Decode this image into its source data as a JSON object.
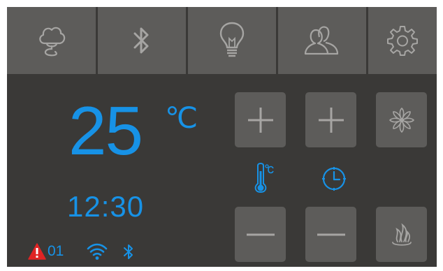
{
  "topbar": {
    "items": [
      {
        "icon": "cloud-icon"
      },
      {
        "icon": "bluetooth-icon"
      },
      {
        "icon": "lightbulb-icon"
      },
      {
        "icon": "users-icon"
      },
      {
        "icon": "gear-icon"
      }
    ]
  },
  "display": {
    "temperature": "25",
    "temperature_unit": "℃",
    "time": "12:30"
  },
  "status": {
    "alarm_count": "01",
    "alarm_icon": "warning-icon",
    "wifi_icon": "wifi-icon",
    "bluetooth_icon": "bluetooth-icon"
  },
  "controls": {
    "temp_icon": "thermometer-celsius-icon",
    "timer_icon": "clock-icon",
    "buttons": [
      "temp-increase",
      "timer-increase",
      "fan",
      "temp-decrease",
      "timer-decrease",
      "heat"
    ]
  },
  "colors": {
    "accent": "#1792e6",
    "panel": "#3a3937",
    "tile": "#5d5c5a",
    "icon": "#a6a5a3",
    "warning": "#e02424"
  }
}
